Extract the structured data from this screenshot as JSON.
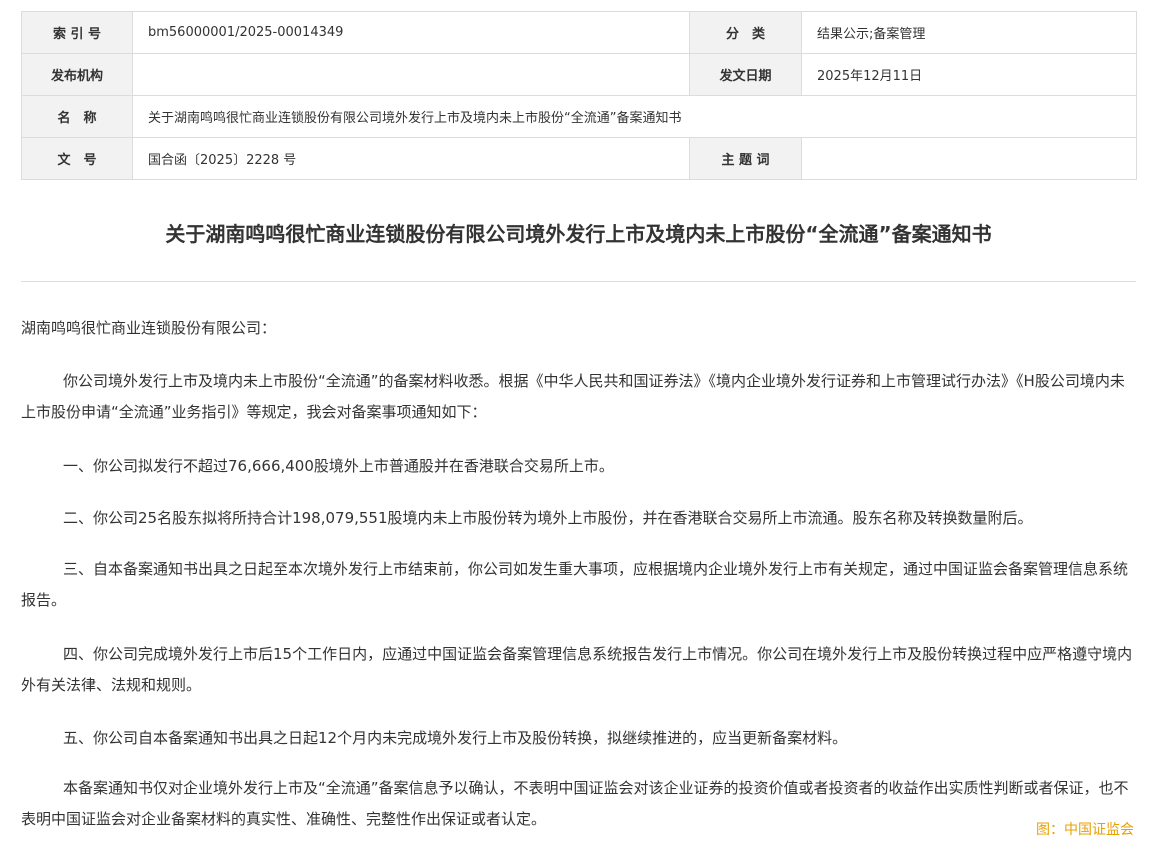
{
  "meta": {
    "row1": {
      "label1": "索 引 号",
      "value1": "bm56000001/2025-00014349",
      "label2": "分　类",
      "value2": "结果公示;备案管理"
    },
    "row2": {
      "label1": "发布机构",
      "value1": "",
      "label2": "发文日期",
      "value2": "2025年12月11日"
    },
    "row3": {
      "label1": "名　称",
      "value1": "关于湖南鸣鸣很忙商业连锁股份有限公司境外发行上市及境内未上市股份“全流通”备案通知书"
    },
    "row4": {
      "label1": "文　号",
      "value1": "国合函〔2025〕2228 号",
      "label2": "主 题 词",
      "value2": ""
    }
  },
  "document": {
    "title": "关于湖南鸣鸣很忙商业连锁股份有限公司境外发行上市及境内未上市股份“全流通”备案通知书",
    "salutation": "湖南鸣鸣很忙商业连锁股份有限公司：",
    "paragraphs": [
      "你公司境外发行上市及境内未上市股份“全流通”的备案材料收悉。根据《中华人民共和国证券法》《境内企业境外发行证券和上市管理试行办法》《H股公司境内未上市股份申请“全流通”业务指引》等规定，我会对备案事项通知如下：",
      "一、你公司拟发行不超过76,666,400股境外上市普通股并在香港联合交易所上市。",
      "二、你公司25名股东拟将所持合计198,079,551股境内未上市股份转为境外上市股份，并在香港联合交易所上市流通。股东名称及转换数量附后。",
      "三、自本备案通知书出具之日起至本次境外发行上市结束前，你公司如发生重大事项，应根据境内企业境外发行上市有关规定，通过中国证监会备案管理信息系统报告。",
      "四、你公司完成境外发行上市后15个工作日内，应通过中国证监会备案管理信息系统报告发行上市情况。你公司在境外发行上市及股份转换过程中应严格遵守境内外有关法律、法规和规则。",
      "五、你公司自本备案通知书出具之日起12个月内未完成境外发行上市及股份转换，拟继续推进的，应当更新备案材料。",
      "本备案通知书仅对企业境外发行上市及“全流通”备案信息予以确认，不表明中国证监会对该企业证券的投资价值或者投资者的收益作出实质性判断或者保证，也不表明中国证监会对企业备案材料的真实性、准确性、完整性作出保证或者认定。"
    ],
    "caption": "图：中国证监会"
  },
  "colors": {
    "label_bg": "#f2f2f2",
    "border": "#dcdcdc",
    "caption": "#e8a000",
    "text": "#333333"
  }
}
